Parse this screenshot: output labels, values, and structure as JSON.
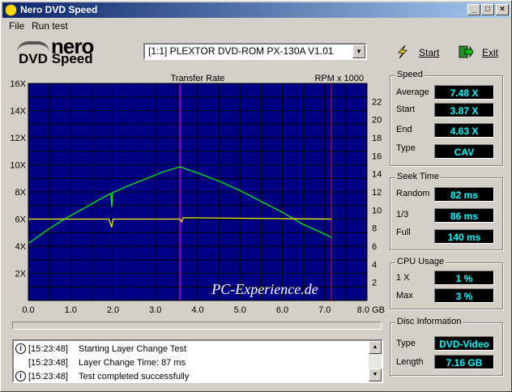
{
  "window": {
    "title": "Nero DVD Speed",
    "controls": {
      "minimize": "_",
      "maximize": "□",
      "close": "×"
    }
  },
  "menu": [
    "File",
    "Run test"
  ],
  "logo": {
    "brand": "nero",
    "product": "DVD Speed"
  },
  "drive_select": {
    "value": "[1:1]  PLEXTOR DVD-ROM PX-130A V1.01"
  },
  "toolbar": {
    "start_label": "Start",
    "exit_label": "Exit"
  },
  "chart_data": {
    "type": "line",
    "title": "Transfer Rate",
    "y2label": "RPM x 1000",
    "xunit": "GB",
    "xlim": [
      0,
      8
    ],
    "ylim": [
      0,
      16
    ],
    "y2lim": [
      0,
      24
    ],
    "x_ticks": [
      "0.0",
      "1.0",
      "2.0",
      "3.0",
      "4.0",
      "5.0",
      "6.0",
      "7.0",
      "8.0 GB"
    ],
    "y_ticks": [
      "2X",
      "4X",
      "6X",
      "8X",
      "10X",
      "12X",
      "14X",
      "16X"
    ],
    "y2_ticks": [
      "2",
      "4",
      "6",
      "8",
      "10",
      "12",
      "14",
      "16",
      "18",
      "20",
      "22"
    ],
    "grid": true,
    "watermark": "PC-Experience.de",
    "markers_x": [
      3.58,
      7.16
    ],
    "series": [
      {
        "name": "Transfer Rate",
        "color": "#00ff00",
        "points": [
          [
            0,
            4.2
          ],
          [
            0.4,
            5.1
          ],
          [
            0.8,
            5.9
          ],
          [
            1.2,
            6.6
          ],
          [
            1.6,
            7.3
          ],
          [
            1.95,
            7.9
          ],
          [
            1.97,
            6.9
          ],
          [
            1.99,
            7.95
          ],
          [
            2.4,
            8.5
          ],
          [
            2.8,
            9.0
          ],
          [
            3.2,
            9.5
          ],
          [
            3.58,
            9.85
          ],
          [
            4.0,
            9.4
          ],
          [
            4.5,
            8.8
          ],
          [
            5.0,
            8.1
          ],
          [
            5.5,
            7.3
          ],
          [
            6.0,
            6.5
          ],
          [
            6.5,
            5.6
          ],
          [
            7.0,
            4.9
          ],
          [
            7.16,
            4.63
          ]
        ]
      },
      {
        "name": "RPM",
        "color": "#ffff00",
        "points": [
          [
            0,
            6.0
          ],
          [
            1.9,
            6.0
          ],
          [
            1.97,
            5.4
          ],
          [
            2.0,
            6.0
          ],
          [
            3.58,
            6.0
          ],
          [
            3.62,
            5.8
          ],
          [
            3.66,
            6.1
          ],
          [
            7.16,
            6.0
          ]
        ]
      }
    ]
  },
  "speed": {
    "title": "Speed",
    "rows": [
      {
        "label": "Average",
        "value": "7.48 X"
      },
      {
        "label": "Start",
        "value": "3.87 X"
      },
      {
        "label": "End",
        "value": "4.63 X"
      },
      {
        "label": "Type",
        "value": "CAV"
      }
    ]
  },
  "seek": {
    "title": "Seek Time",
    "rows": [
      {
        "label": "Random",
        "value": "82 ms"
      },
      {
        "label": "1/3",
        "value": "86 ms"
      },
      {
        "label": "Full",
        "value": "140 ms"
      }
    ]
  },
  "cpu": {
    "title": "CPU Usage",
    "rows": [
      {
        "label": "1 X",
        "value": "1 %"
      },
      {
        "label": "Max",
        "value": "3 %"
      }
    ]
  },
  "disc": {
    "title": "Disc Information",
    "rows": [
      {
        "label": "Type",
        "value": "DVD-Video"
      },
      {
        "label": "Length",
        "value": "7.16 GB"
      }
    ]
  },
  "log": [
    {
      "time": "[15:23:48]",
      "msg": "Starting Layer Change Test",
      "icon": "info-icon"
    },
    {
      "time": "[15:23:48]",
      "msg": "Layer Change Time:   87 ms",
      "icon": ""
    },
    {
      "time": "[15:23:48]",
      "msg": "Test completed successfully",
      "icon": "info-icon"
    }
  ]
}
